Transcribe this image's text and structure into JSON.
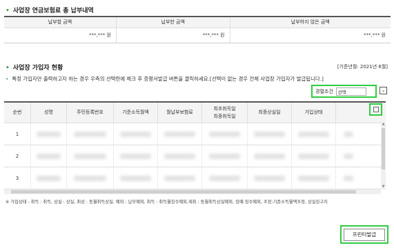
{
  "summary": {
    "title": "사업장 연금보험료 총 납부내역",
    "headers": [
      "납부할 금액",
      "납부한 금액",
      "납부하지 않은 금액"
    ],
    "values": [
      "***,*** 원",
      "***,*** 원",
      "***,*** 원"
    ]
  },
  "members": {
    "title": "사업장 가입자 현황",
    "std_date": "[기준년월: 2021년 6월]",
    "notice": "특정 가입자만 출력하고자 하는 경우 우측의 선택란에 체크 후 증명서발급 버튼을 클릭하세요.[선택이 없는 경우 전체 사업장 가입자가 발급됩니다.]",
    "filter_label": "경렬조건",
    "filter_value": "선택",
    "columns": [
      {
        "l1": "순번",
        "l2": ""
      },
      {
        "l1": "성명",
        "l2": ""
      },
      {
        "l1": "주민등록번호",
        "l2": ""
      },
      {
        "l1": "기준소득월액",
        "l2": ""
      },
      {
        "l1": "월납부보험료",
        "l2": ""
      },
      {
        "l1": "최초취득일",
        "l2": "최종취득일"
      },
      {
        "l1": "최종상실일",
        "l2": ""
      },
      {
        "l1": "가입상태",
        "l2": ""
      }
    ],
    "rows": [
      "1",
      "2",
      "3"
    ],
    "partial_date": "2015-12-01"
  },
  "footnote": "※ 가입상태 - 취득 : 취득, 상실 : 상실, 취상 : 동월취득상실, 예외 : 납부예외, 취득 : 취득월징수예외,재취 : 동월취득상실예외, 징예:징수예외, 조정:기준소득월액조정, 상실징고지",
  "print_label": "프린터발급",
  "colors": {
    "accent": "#2ecc40",
    "bullet": "#3aa44b"
  }
}
